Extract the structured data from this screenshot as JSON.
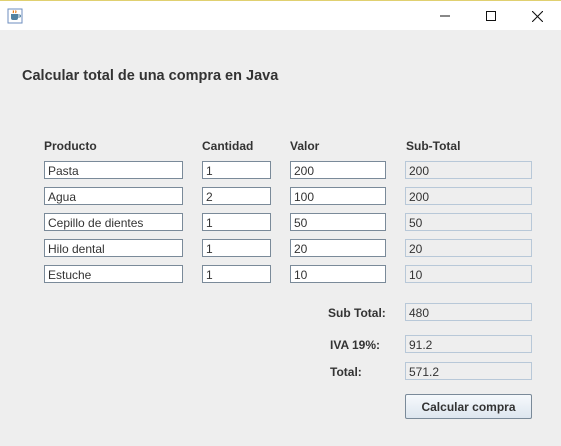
{
  "window": {
    "app_icon": "java-cup-icon",
    "minimize_icon": "minimize-icon",
    "maximize_icon": "maximize-icon",
    "close_icon": "close-icon"
  },
  "heading": "Calcular total de una compra en Java",
  "columns": {
    "producto": "Producto",
    "cantidad": "Cantidad",
    "valor": "Valor",
    "subtotal": "Sub-Total"
  },
  "rows": [
    {
      "producto": "Pasta",
      "cantidad": "1",
      "valor": "200",
      "subtotal": "200"
    },
    {
      "producto": "Agua",
      "cantidad": "2",
      "valor": "100",
      "subtotal": "200"
    },
    {
      "producto": "Cepillo de dientes",
      "cantidad": "1",
      "valor": "50",
      "subtotal": "50"
    },
    {
      "producto": "Hilo dental",
      "cantidad": "1",
      "valor": "20",
      "subtotal": "20"
    },
    {
      "producto": "Estuche",
      "cantidad": "1",
      "valor": "10",
      "subtotal": "10"
    }
  ],
  "summary": {
    "subtotal_label": "Sub Total:",
    "subtotal_value": "480",
    "iva_label": "IVA 19%:",
    "iva_value": "91.2",
    "total_label": "Total:",
    "total_value": "571.2"
  },
  "button": {
    "label": "Calcular compra"
  }
}
